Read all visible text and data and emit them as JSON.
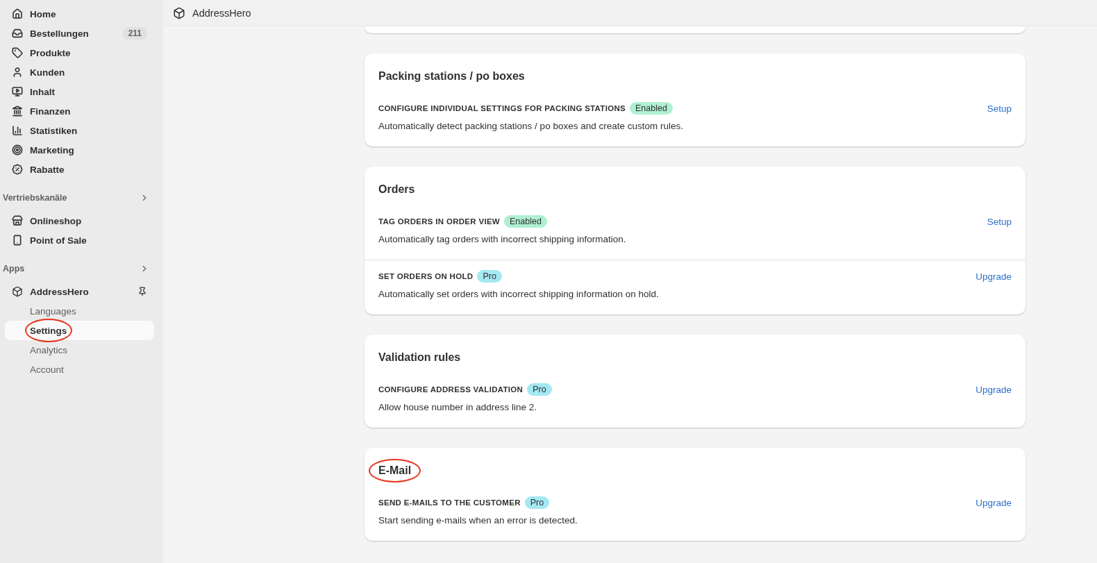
{
  "sidebar": {
    "items": [
      {
        "label": "Home",
        "selected": false
      },
      {
        "label": "Bestellungen",
        "badge": "211",
        "selected": false
      },
      {
        "label": "Produkte",
        "selected": false
      },
      {
        "label": "Kunden",
        "selected": false
      },
      {
        "label": "Inhalt",
        "selected": false
      },
      {
        "label": "Finanzen",
        "selected": false
      },
      {
        "label": "Statistiken",
        "selected": false
      },
      {
        "label": "Marketing",
        "selected": false
      },
      {
        "label": "Rabatte",
        "selected": false
      }
    ],
    "sections": [
      {
        "title": "Vertriebskanäle",
        "items": [
          {
            "label": "Onlineshop",
            "selected": false
          },
          {
            "label": "Point of Sale",
            "selected": false
          }
        ]
      },
      {
        "title": "Apps",
        "app": {
          "label": "AddressHero",
          "children": [
            {
              "label": "Languages",
              "selected": false,
              "circled": false
            },
            {
              "label": "Settings",
              "selected": true,
              "circled": true
            },
            {
              "label": "Analytics",
              "selected": false,
              "circled": false
            },
            {
              "label": "Account",
              "selected": false,
              "circled": false
            }
          ]
        }
      }
    ]
  },
  "topbar": {
    "title": "AddressHero"
  },
  "cards": [
    {
      "title": "Packing stations / po boxes",
      "circled": false,
      "rows": [
        {
          "heading": "CONFIGURE INDIVIDUAL SETTINGS FOR PACKING STATIONS",
          "badge": {
            "text": "Enabled",
            "kind": "enabled"
          },
          "description": "Automatically detect packing stations / po boxes and create custom rules.",
          "action": "Setup"
        }
      ]
    },
    {
      "title": "Orders",
      "circled": false,
      "rows": [
        {
          "heading": "TAG ORDERS IN ORDER VIEW",
          "badge": {
            "text": "Enabled",
            "kind": "enabled"
          },
          "description": "Automatically tag orders with incorrect shipping information.",
          "action": "Setup"
        },
        {
          "heading": "SET ORDERS ON HOLD",
          "badge": {
            "text": "Pro",
            "kind": "pro"
          },
          "description": "Automatically set orders with incorrect shipping information on hold.",
          "action": "Upgrade"
        }
      ]
    },
    {
      "title": "Validation rules",
      "circled": false,
      "rows": [
        {
          "heading": "CONFIGURE ADDRESS VALIDATION",
          "badge": {
            "text": "Pro",
            "kind": "pro"
          },
          "description": "Allow house number in address line 2.",
          "action": "Upgrade"
        }
      ]
    },
    {
      "title": "E-Mail",
      "circled": true,
      "rows": [
        {
          "heading": "SEND E-MAILS TO THE CUSTOMER",
          "badge": {
            "text": "Pro",
            "kind": "pro"
          },
          "description": "Start sending e-mails when an error is detected.",
          "action": "Upgrade"
        }
      ]
    }
  ]
}
